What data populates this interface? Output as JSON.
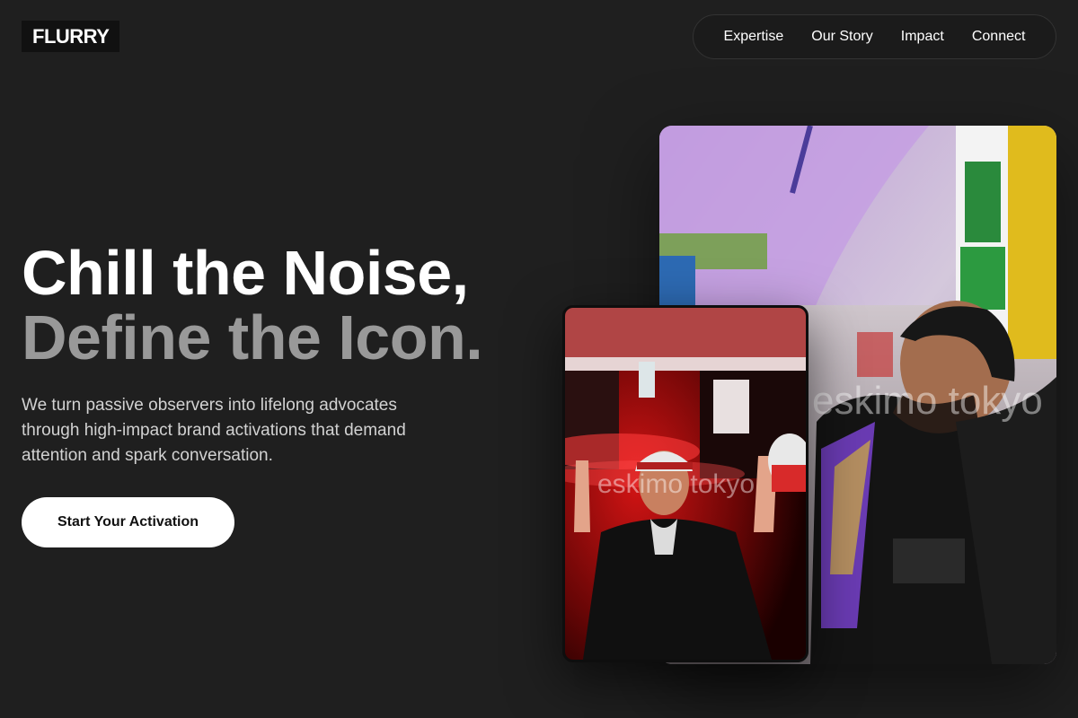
{
  "header": {
    "logo": "FLURRY",
    "nav": [
      "Expertise",
      "Our Story",
      "Impact",
      "Connect"
    ]
  },
  "hero": {
    "line1": "Chill the Noise,",
    "line2": "Define the Icon.",
    "description": "We turn passive observers into lifelong advocates through high-impact brand activations that demand attention and spark conversation.",
    "cta": "Start Your Activation"
  },
  "images": {
    "large_watermark": "eskimo tokyo",
    "small_watermark": "eskimo tokyo"
  },
  "colors": {
    "background": "#1f1f1f",
    "headline_primary": "#ffffff",
    "headline_secondary": "#999999",
    "cta_background": "#ffffff"
  }
}
